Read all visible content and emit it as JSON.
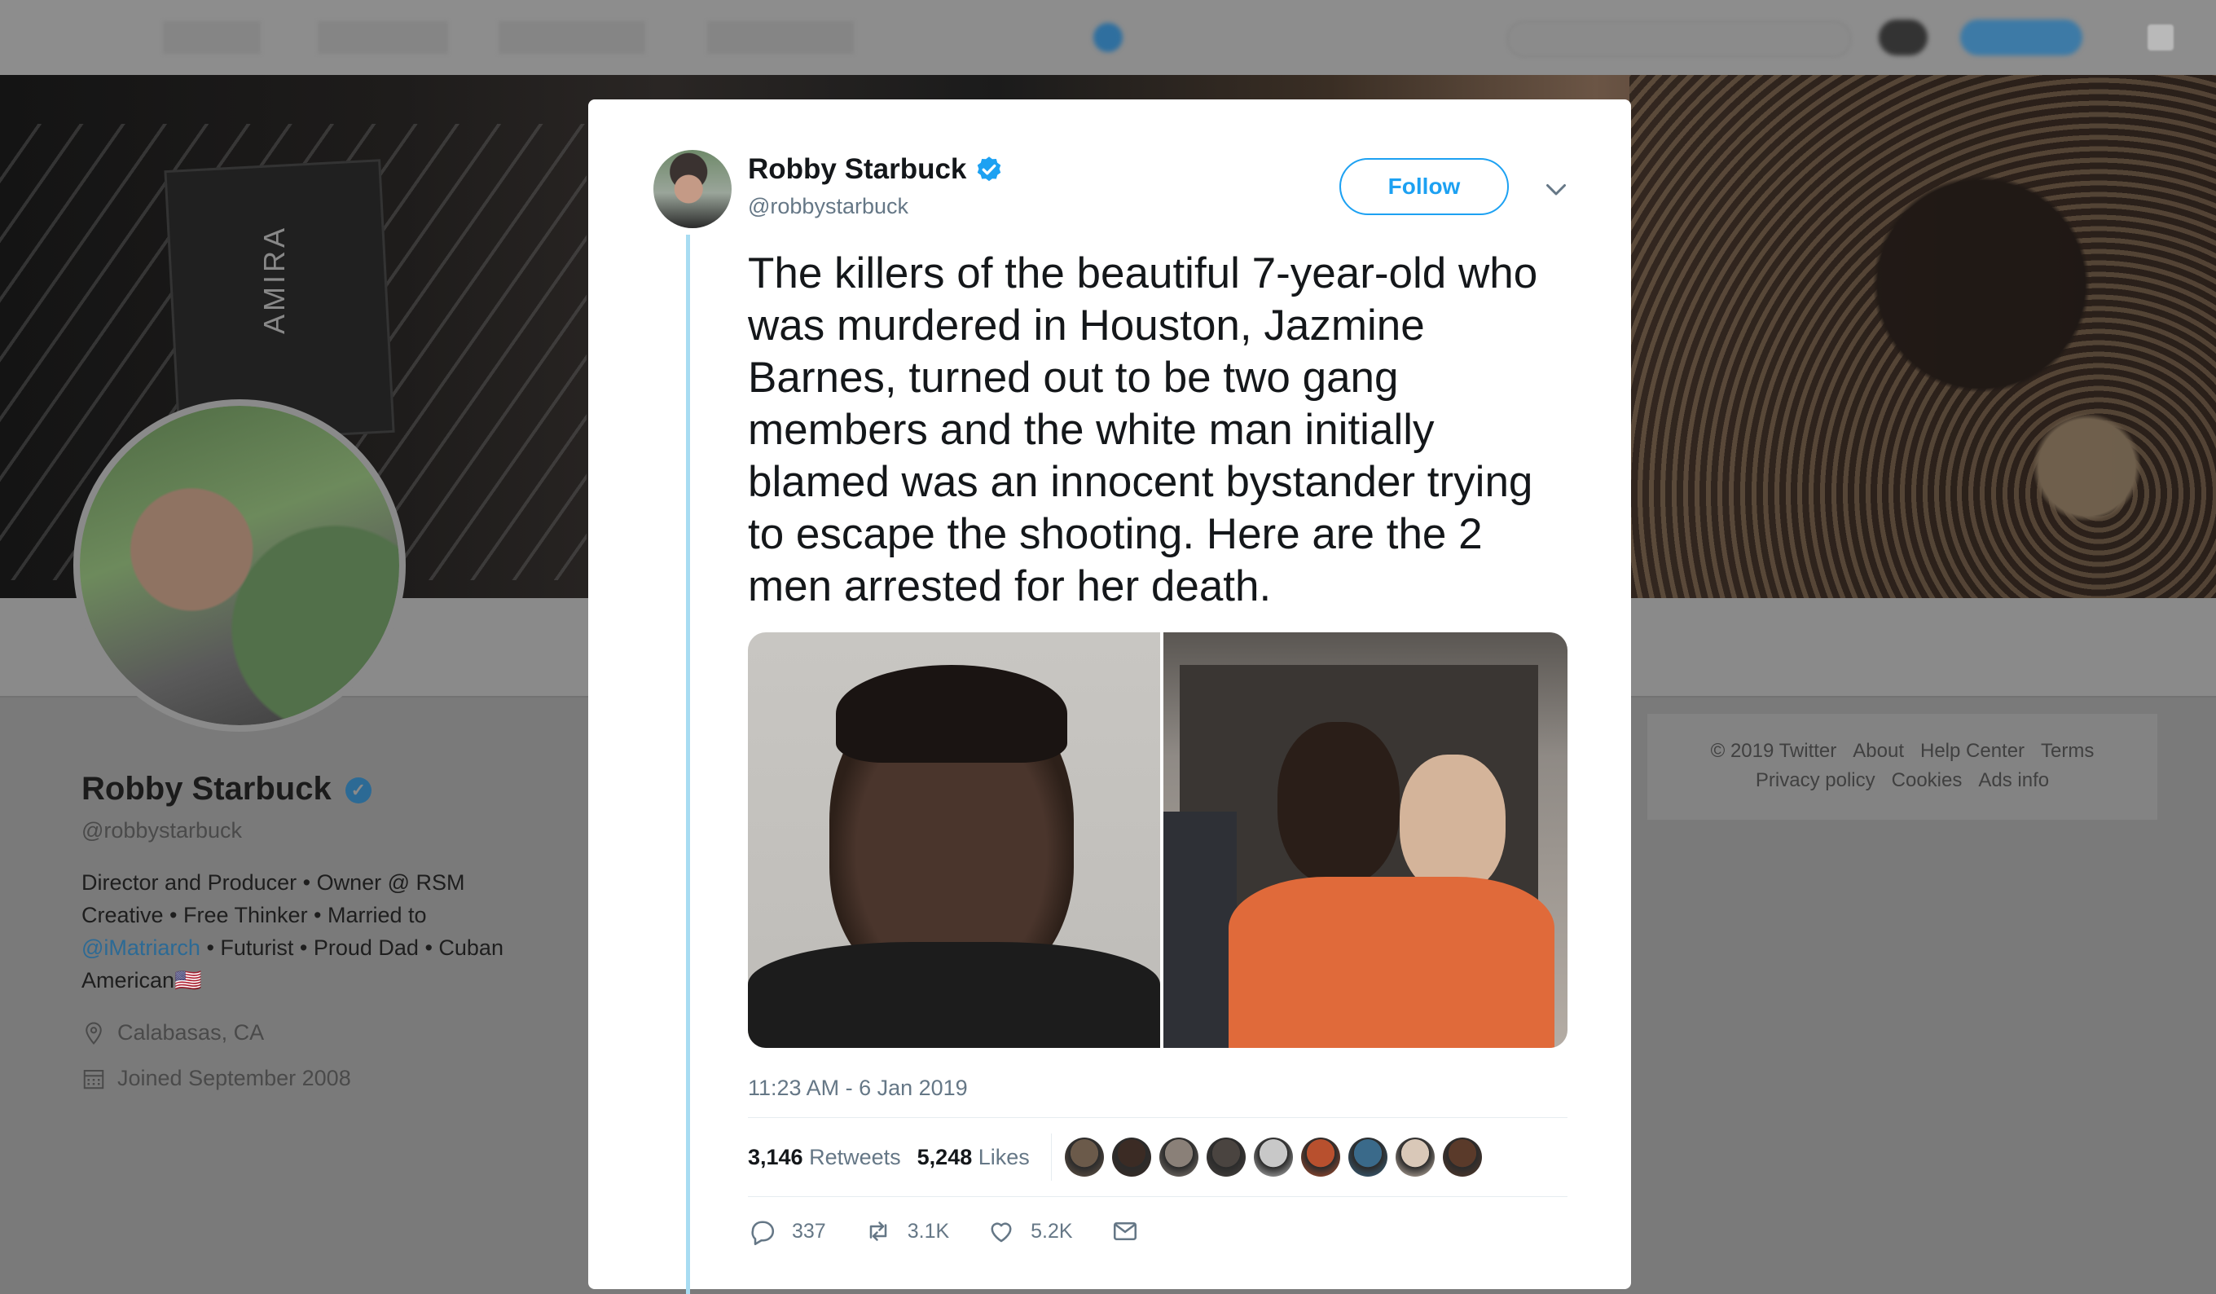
{
  "background_profile": {
    "name": "Robby Starbuck",
    "handle": "@robbystarbuck",
    "bio_parts": {
      "line1": "Director and Producer • Owner @ RSM",
      "line2": "Creative • Free Thinker • Married to",
      "mention": "@iMatriarch",
      "line3_rest": " • Futurist • Proud Dad • Cuban",
      "line4": "American🇺🇸"
    },
    "location": "Calabasas, CA",
    "joined": "Joined September 2008",
    "banner_camera_text": "AMIRA"
  },
  "footer": {
    "row1": [
      "© 2019 Twitter",
      "About",
      "Help Center",
      "Terms"
    ],
    "row2": [
      "Privacy policy",
      "Cookies",
      "Ads info"
    ]
  },
  "tweet": {
    "author_name": "Robby Starbuck",
    "author_handle": "@robbystarbuck",
    "follow_label": "Follow",
    "text": "The killers of the beautiful 7-year-old who was murdered in Houston, Jazmine Barnes, turned out to be two gang members and the white man initially blamed was an innocent bystander trying to escape the shooting. Here are the 2 men arrested for her death.",
    "timestamp": "11:23 AM - 6 Jan 2019",
    "retweets_count": "3,146",
    "retweets_label": "Retweets",
    "likes_count": "5,248",
    "likes_label": "Likes",
    "actions": {
      "reply_count": "337",
      "retweet_count": "3.1K",
      "like_count": "5.2K"
    },
    "liker_colors": [
      "#6b5a4a",
      "#3b2b24",
      "#8a8078",
      "#4a4440",
      "#c8c8c8",
      "#b8502e",
      "#3a6a8a",
      "#d9c8b8",
      "#5a3a2a"
    ]
  },
  "colors": {
    "accent": "#1da1f2",
    "text_primary": "#14171a",
    "text_secondary": "#657786",
    "overlay": "#7a7a7a"
  }
}
